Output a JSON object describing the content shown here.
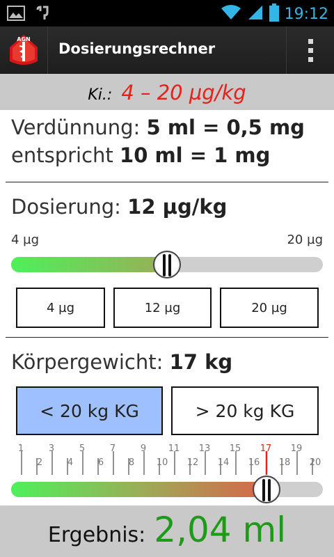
{
  "status_bar": {
    "time": "19:12",
    "icons": [
      "image-notification-icon",
      "usb-notification-icon",
      "wifi-icon",
      "signal-icon",
      "battery-icon"
    ]
  },
  "action_bar": {
    "title": "Dosierungsrechner",
    "app_icon": "agn-logo-icon",
    "app_icon_text": "AGN",
    "overflow_icon": "overflow-menu-icon"
  },
  "ki": {
    "label": "Ki.:",
    "value": "4 – 20 µg/kg"
  },
  "verduennung": {
    "line1_label": "Verdünnung:",
    "line1_value": "5 ml = 0,5 mg",
    "line2_label": "entspricht",
    "line2_value": "10 ml = 1 mg"
  },
  "dosierung": {
    "label": "Dosierung:",
    "value": "12 µg/kg",
    "min_label": "4 µg",
    "max_label": "20 µg",
    "slider_min": 4,
    "slider_max": 20,
    "slider_value": 12,
    "presets": [
      "4 µg",
      "12 µg",
      "20 µg"
    ]
  },
  "gewicht": {
    "label": "Körpergewicht:",
    "value": "17 kg",
    "range_buttons": [
      "< 20 kg KG",
      "> 20 kg KG"
    ],
    "active_range": 0,
    "ruler_ticks": [
      "1",
      "2",
      "3",
      "4",
      "5",
      "6",
      "7",
      "8",
      "9",
      "10",
      "11",
      "12",
      "13",
      "14",
      "15",
      "16",
      "17",
      "18",
      "19",
      "20"
    ],
    "slider_min": 1,
    "slider_max": 20,
    "slider_value": 17
  },
  "ergebnis": {
    "label": "Ergebnis:",
    "value": "2,04 ml"
  },
  "colors": {
    "accent_red": "#e8201a",
    "result_green": "#1c9a18",
    "time_blue": "#33b5e5",
    "active_button": "#9fc0ff"
  }
}
